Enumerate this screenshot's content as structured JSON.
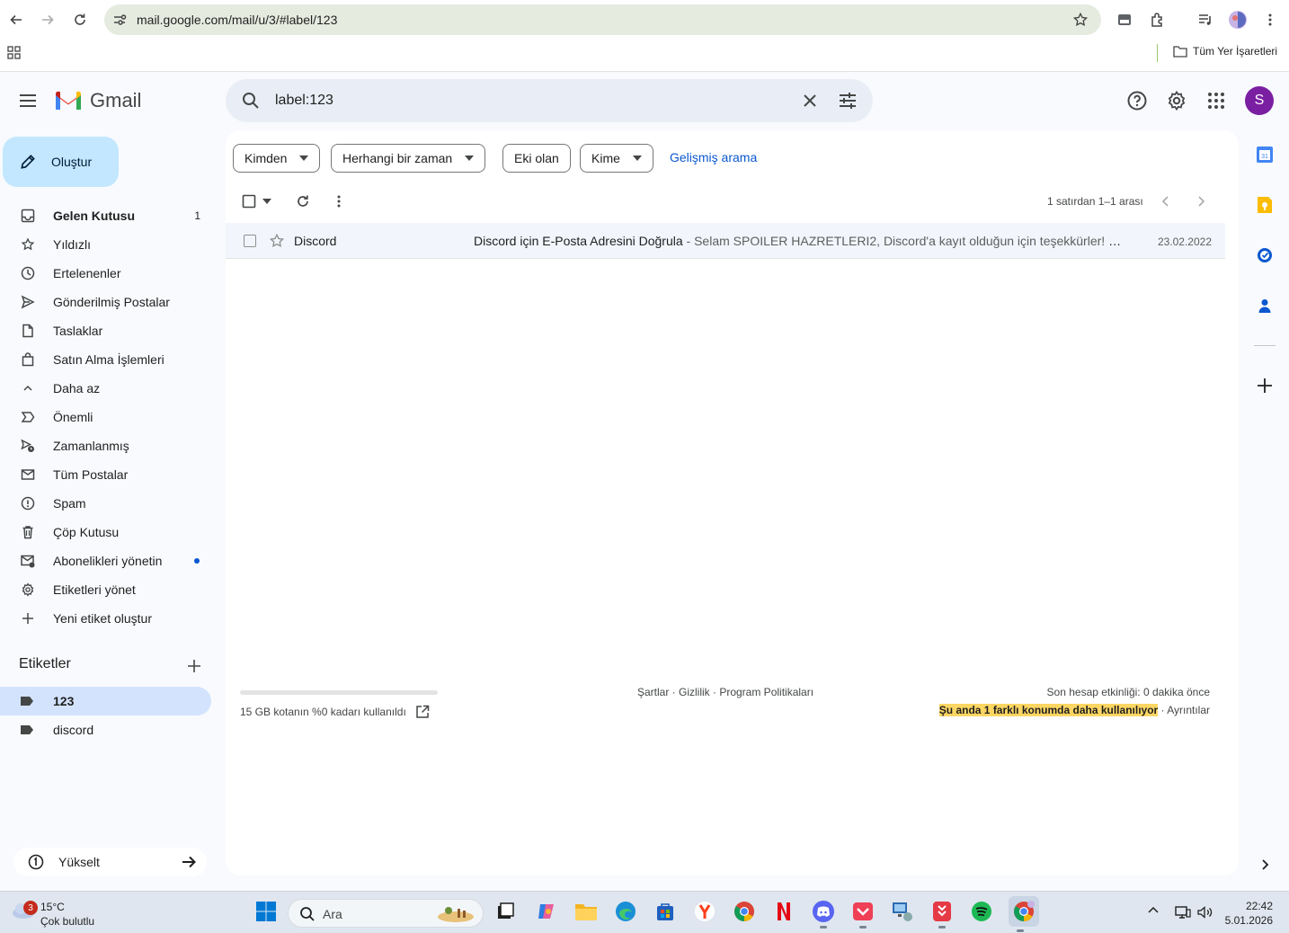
{
  "browser": {
    "url": "mail.google.com/mail/u/3/#label/123",
    "bookmarks_folder": "Tüm Yer İşaretleri"
  },
  "gmail": {
    "wordmark": "Gmail",
    "search_value": "label:123",
    "avatar_letter": "S",
    "compose_label": "Oluştur"
  },
  "nav": [
    {
      "label": "Gelen Kutusu",
      "icon": "inbox-icon",
      "count": "1",
      "bold": true
    },
    {
      "label": "Yıldızlı",
      "icon": "star-icon"
    },
    {
      "label": "Ertelenenler",
      "icon": "clock-icon"
    },
    {
      "label": "Gönderilmiş Postalar",
      "icon": "send-icon"
    },
    {
      "label": "Taslaklar",
      "icon": "draft-icon"
    },
    {
      "label": "Satın Alma İşlemleri",
      "icon": "shopping-bag-icon"
    },
    {
      "label": "Daha az",
      "icon": "chevron-up-icon"
    },
    {
      "label": "Önemli",
      "icon": "important-icon"
    },
    {
      "label": "Zamanlanmış",
      "icon": "scheduled-send-icon"
    },
    {
      "label": "Tüm Postalar",
      "icon": "all-mail-icon"
    },
    {
      "label": "Spam",
      "icon": "spam-icon"
    },
    {
      "label": "Çöp Kutusu",
      "icon": "trash-icon"
    },
    {
      "label": "Abonelikleri yönetin",
      "icon": "manage-subscriptions-icon",
      "dot": true
    },
    {
      "label": "Etiketleri yönet",
      "icon": "gear-icon"
    },
    {
      "label": "Yeni etiket oluştur",
      "icon": "plus-icon"
    }
  ],
  "labels": {
    "title": "Etiketler",
    "items": [
      {
        "label": "123",
        "active": true
      },
      {
        "label": "discord",
        "active": false
      }
    ]
  },
  "upgrade_label": "Yükselt",
  "filters": {
    "from": "Kimden",
    "time": "Herhangi bir zaman",
    "has_attachment": "Eki olan",
    "to": "Kime",
    "advanced": "Gelişmiş arama"
  },
  "pager_text": "1 satırdan 1–1 arası",
  "emails": [
    {
      "sender": "Discord",
      "subject": "Discord için E-Posta Adresini Doğrula",
      "snippet": " - Selam SPOILER HAZRETLERI2, Discord'a kayıt olduğun için teşekkürler! B...",
      "date": "23.02.2022"
    }
  ],
  "footer": {
    "storage": "15 GB kotanın %0 kadarı kullanıldı",
    "storage_used_fraction": 0,
    "links": "Şartlar · Gizlilik · Program Politikaları",
    "last_activity": "Son hesap etkinliği: 0 dakika önce",
    "warning": "Şu anda 1 farklı konumda daha kullanılıyor",
    "details": " · Ayrıntılar"
  },
  "taskbar": {
    "weather_badge": "3",
    "temperature": "15°C",
    "condition": "Çok bulutlu",
    "search_label": "Ara",
    "time": "22:42",
    "date": "5.01.2026"
  }
}
